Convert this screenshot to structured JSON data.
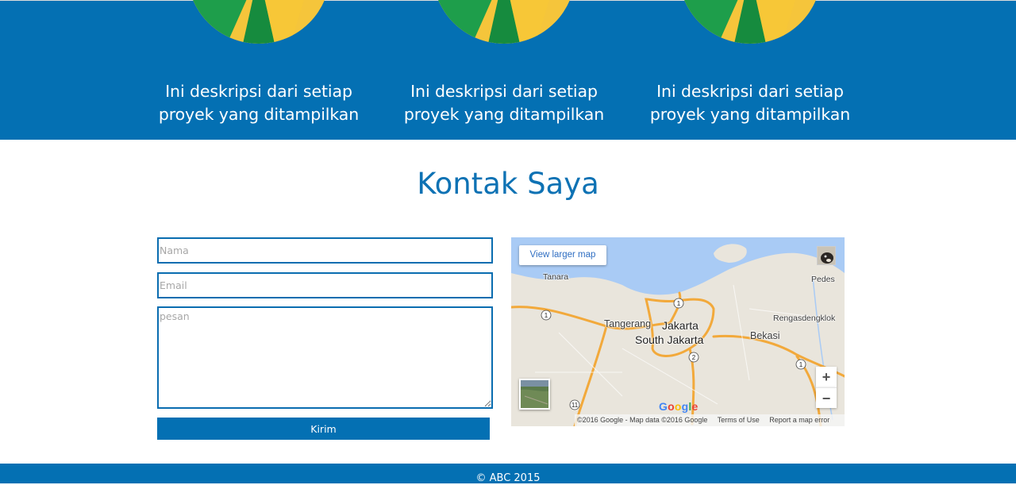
{
  "projects": {
    "items": [
      {
        "description": "Ini deskripsi dari setiap proyek yang ditampilkan",
        "logo_icon": "chrome-logo-icon"
      },
      {
        "description": "Ini deskripsi dari setiap proyek yang ditampilkan",
        "logo_icon": "chrome-logo-icon"
      },
      {
        "description": "Ini deskripsi dari setiap proyek yang ditampilkan",
        "logo_icon": "chrome-logo-icon"
      }
    ]
  },
  "contact": {
    "title": "Kontak Saya",
    "name_placeholder": "Nama",
    "email_placeholder": "Email",
    "message_placeholder": "pesan",
    "submit_label": "Kirim"
  },
  "map": {
    "view_larger_label": "View larger map",
    "labels": {
      "tanara": "Tanara",
      "pedes": "Pedes",
      "tangerang": "Tangerang",
      "jakarta": "Jakarta",
      "south_jakarta": "South Jakarta",
      "bekasi": "Bekasi",
      "rengasdengklok": "Rengasdengklok"
    },
    "zoom_in_label": "+",
    "zoom_out_label": "−",
    "attribution": "©2016 Google - Map data ©2016 Google",
    "terms_label": "Terms of Use",
    "report_label": "Report a map error",
    "colors": {
      "water": "#a9cbf5",
      "land": "#e9e5dc",
      "highway": "#f2a93b"
    }
  },
  "footer": {
    "text": "© ABC 2015"
  },
  "colors": {
    "brand": "#0470b3",
    "accent_text": "#0e72b4",
    "white": "#ffffff"
  }
}
